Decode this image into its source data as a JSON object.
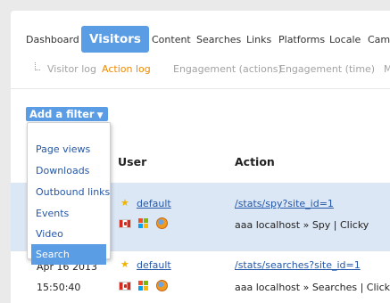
{
  "main_nav": {
    "items": [
      "Dashboard",
      "Visitors",
      "Content",
      "Searches",
      "Links",
      "Platforms",
      "Locale",
      "Camp"
    ],
    "active": "Visitors"
  },
  "sub_nav": {
    "items": [
      "Visitor log",
      "Action log",
      "Engagement (actions)",
      "Engagement (time)",
      "M"
    ],
    "active": "Action log"
  },
  "filter": {
    "button_label": "Add a filter",
    "arrow": "▼",
    "options": [
      "Page views",
      "Downloads",
      "Outbound links",
      "Events",
      "Video",
      "Search"
    ],
    "selected": "Search"
  },
  "table": {
    "headers": {
      "user": "User",
      "action": "Action"
    },
    "rows": [
      {
        "highlighted": true,
        "user_link": "default",
        "action_link": "/stats/spy?site_id=1",
        "action_detail": "aaa localhost » Spy | Clicky",
        "icons": [
          "star-icon",
          "canada-flag-icon",
          "windows-icon",
          "firefox-icon"
        ]
      },
      {
        "highlighted": false,
        "date": "Apr 16 2013",
        "time": "15:50:40",
        "user_link": "default",
        "action_link": "/stats/searches?site_id=1",
        "action_detail": "aaa localhost » Searches | Clicky",
        "icons": [
          "star-icon",
          "canada-flag-icon",
          "windows-icon",
          "firefox-icon"
        ]
      }
    ]
  },
  "colors": {
    "accent": "#5b9de4",
    "active_subtab": "#f08a00",
    "link": "#2457a8",
    "row_highlight": "#dce7f5"
  }
}
